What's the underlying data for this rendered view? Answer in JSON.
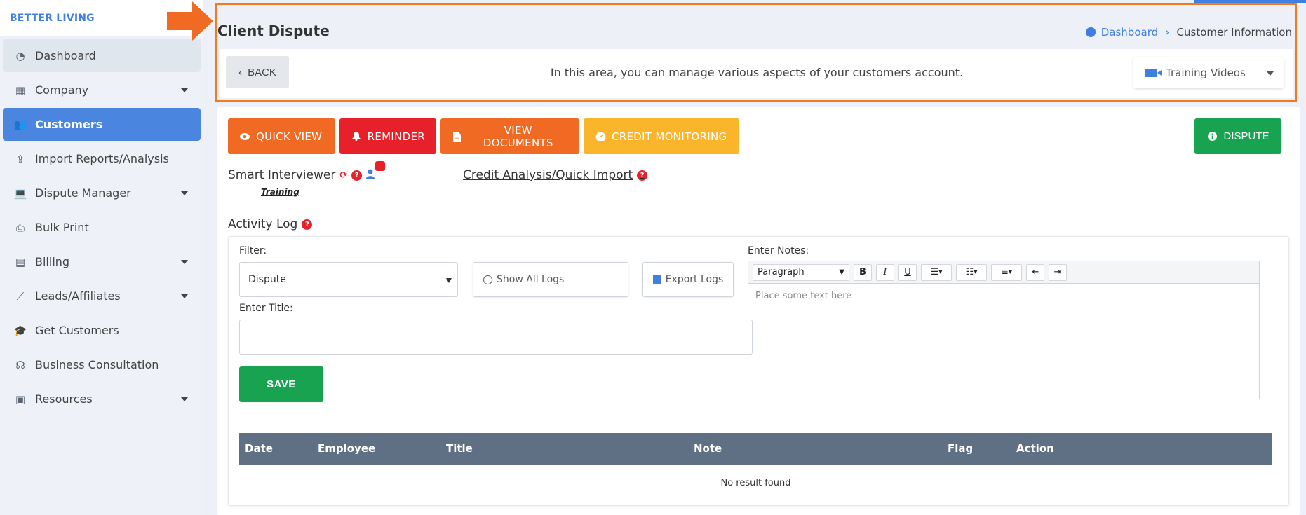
{
  "brand": "BETTER LIVING",
  "sidebar": {
    "items": [
      {
        "label": "Dashboard",
        "icon": "pie-chart-icon",
        "state": "hover",
        "has_caret": false
      },
      {
        "label": "Company",
        "icon": "building-icon",
        "state": "",
        "has_caret": true
      },
      {
        "label": "Customers",
        "icon": "users-icon",
        "state": "active",
        "has_caret": false
      },
      {
        "label": "Import Reports/Analysis",
        "icon": "file-import-icon",
        "state": "",
        "has_caret": false
      },
      {
        "label": "Dispute Manager",
        "icon": "laptop-icon",
        "state": "",
        "has_caret": true
      },
      {
        "label": "Bulk Print",
        "icon": "printer-icon",
        "state": "",
        "has_caret": false
      },
      {
        "label": "Billing",
        "icon": "invoice-icon",
        "state": "",
        "has_caret": true
      },
      {
        "label": "Leads/Affiliates",
        "icon": "line-chart-icon",
        "state": "",
        "has_caret": true
      },
      {
        "label": "Get Customers",
        "icon": "graduation-cap-icon",
        "state": "",
        "has_caret": false
      },
      {
        "label": "Business Consultation",
        "icon": "headset-icon",
        "state": "",
        "has_caret": false
      },
      {
        "label": "Resources",
        "icon": "boxes-icon",
        "state": "",
        "has_caret": true
      }
    ]
  },
  "header": {
    "title": "Client Dispute",
    "breadcrumb": {
      "link": "Dashboard",
      "current": "Customer Information"
    },
    "back_label": "BACK",
    "info_text": "In this area, you can manage various aspects of your customers account.",
    "training_label": "Training Videos"
  },
  "actions": {
    "quick_view": "QUICK VIEW",
    "reminder": "REMINDER",
    "view_documents": "VIEW DOCUMENTS",
    "credit_monitoring": "CREDIT MONITORING",
    "dispute": "DISPUTE"
  },
  "links": {
    "smart_interviewer": "Smart Interviewer",
    "training": "Training",
    "credit_analysis": "Credit Analysis/Quick Import"
  },
  "activity": {
    "title": "Activity Log",
    "filter_label": "Filter:",
    "filter_value": "Dispute",
    "show_all": "Show All Logs",
    "export": "Export Logs",
    "title_label": "Enter Title:",
    "save": "SAVE",
    "notes_label": "Enter Notes:",
    "editor_format": "Paragraph",
    "editor_placeholder": "Place some text here",
    "columns": [
      "Date",
      "Employee",
      "Title",
      "Note",
      "Flag",
      "Action"
    ],
    "empty": "No result found"
  },
  "colors": {
    "primary": "#3f7fe0",
    "orange": "#f06a24",
    "red": "#e8202a",
    "yellow": "#fbb52a",
    "green": "#18a350",
    "table_header": "#5f6f84",
    "highlight_border": "#f07a24"
  }
}
